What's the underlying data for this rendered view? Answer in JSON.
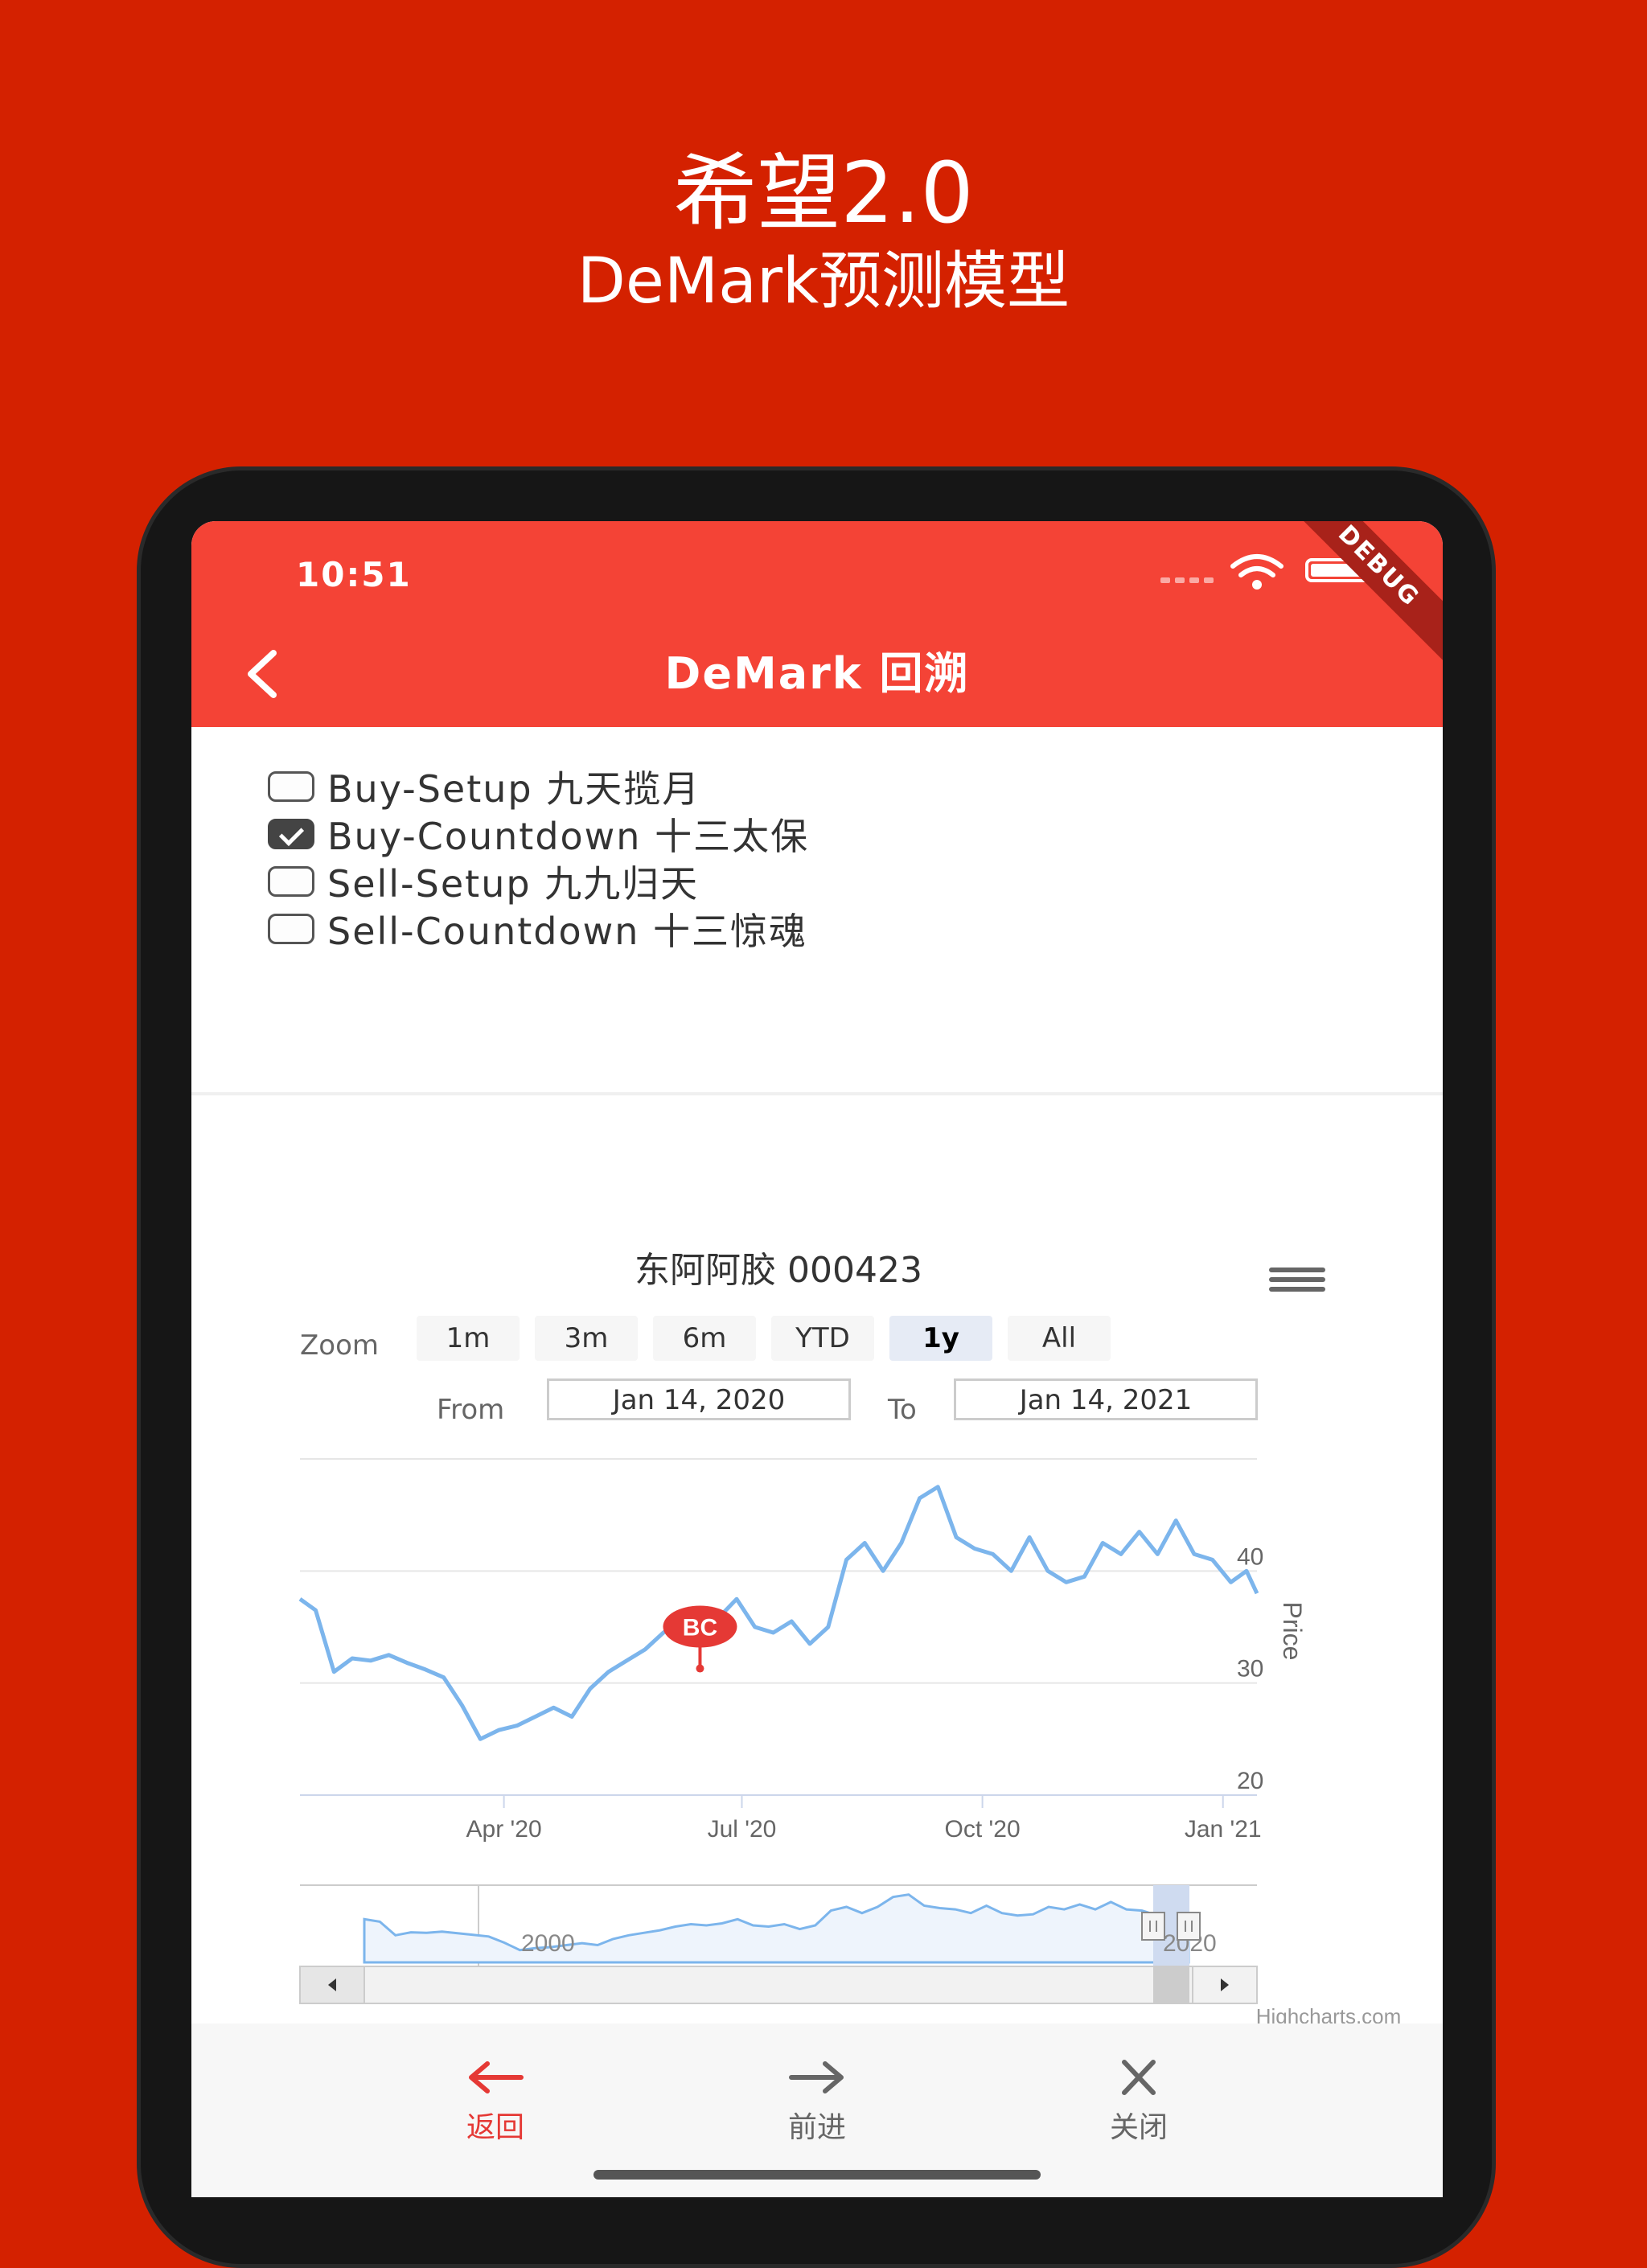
{
  "hero": {
    "title": "希望2.0",
    "subtitle": "DeMark预测模型"
  },
  "status": {
    "time": "10:51",
    "debug": "DEBUG"
  },
  "appbar": {
    "title": "DeMark 回溯"
  },
  "options": [
    {
      "label": "Buy-Setup 九天揽月",
      "checked": false
    },
    {
      "label": "Buy-Countdown 十三太保",
      "checked": true
    },
    {
      "label": "Sell-Setup 九九归天",
      "checked": false
    },
    {
      "label": "Sell-Countdown 十三惊魂",
      "checked": false
    }
  ],
  "chart": {
    "zoom_label": "Zoom",
    "zoom_buttons": [
      "1m",
      "3m",
      "6m",
      "YTD",
      "1y",
      "All"
    ],
    "zoom_active": "1y",
    "from_label": "From",
    "from_value": "Jan 14, 2020",
    "to_label": "To",
    "to_value": "Jan 14, 2021",
    "credit": "Highcharts.com",
    "flag_label": "BC",
    "navigator_labels": [
      "2000",
      "2020"
    ]
  },
  "chart_data": {
    "type": "line",
    "title": "东阿阿胶 000423",
    "ylabel": "Price",
    "xlabel": "",
    "ylim": [
      20,
      50
    ],
    "y_ticks": [
      20,
      30,
      40
    ],
    "x_ticks": [
      "Apr '20",
      "Jul '20",
      "Oct '20",
      "Jan '21"
    ],
    "x_range": [
      "2020-01-14",
      "2021-01-14"
    ],
    "grid": true,
    "series": [
      {
        "values": [
          [
            "2020-01-14",
            37.5
          ],
          [
            "2020-01-20",
            36.5
          ],
          [
            "2020-01-27",
            31.0
          ],
          [
            "2020-02-03",
            32.2
          ],
          [
            "2020-02-10",
            32.0
          ],
          [
            "2020-02-17",
            32.5
          ],
          [
            "2020-02-24",
            31.8
          ],
          [
            "2020-03-02",
            31.2
          ],
          [
            "2020-03-09",
            30.5
          ],
          [
            "2020-03-16",
            28.0
          ],
          [
            "2020-03-23",
            25.0
          ],
          [
            "2020-03-30",
            25.8
          ],
          [
            "2020-04-06",
            26.2
          ],
          [
            "2020-04-13",
            27.0
          ],
          [
            "2020-04-20",
            27.8
          ],
          [
            "2020-04-27",
            27.0
          ],
          [
            "2020-05-04",
            29.5
          ],
          [
            "2020-05-11",
            31.0
          ],
          [
            "2020-05-18",
            32.0
          ],
          [
            "2020-05-25",
            33.0
          ],
          [
            "2020-06-01",
            34.5
          ],
          [
            "2020-06-08",
            35.5
          ],
          [
            "2020-06-15",
            35.0
          ],
          [
            "2020-06-22",
            35.8
          ],
          [
            "2020-06-29",
            37.5
          ],
          [
            "2020-07-06",
            35.0
          ],
          [
            "2020-07-13",
            34.5
          ],
          [
            "2020-07-20",
            35.5
          ],
          [
            "2020-07-27",
            33.5
          ],
          [
            "2020-08-03",
            35.0
          ],
          [
            "2020-08-10",
            41.0
          ],
          [
            "2020-08-17",
            42.5
          ],
          [
            "2020-08-24",
            40.0
          ],
          [
            "2020-08-31",
            42.5
          ],
          [
            "2020-09-07",
            46.5
          ],
          [
            "2020-09-14",
            47.5
          ],
          [
            "2020-09-21",
            43.0
          ],
          [
            "2020-09-28",
            42.0
          ],
          [
            "2020-10-05",
            41.5
          ],
          [
            "2020-10-12",
            40.0
          ],
          [
            "2020-10-19",
            43.0
          ],
          [
            "2020-10-26",
            40.0
          ],
          [
            "2020-11-02",
            39.0
          ],
          [
            "2020-11-09",
            39.5
          ],
          [
            "2020-11-16",
            42.5
          ],
          [
            "2020-11-23",
            41.5
          ],
          [
            "2020-11-30",
            43.5
          ],
          [
            "2020-12-07",
            41.5
          ],
          [
            "2020-12-14",
            44.5
          ],
          [
            "2020-12-21",
            41.5
          ],
          [
            "2020-12-28",
            41.0
          ],
          [
            "2021-01-04",
            39.0
          ],
          [
            "2021-01-10",
            40.0
          ],
          [
            "2021-01-14",
            38.0
          ]
        ]
      }
    ],
    "flags": [
      {
        "date": "2020-06-15",
        "value": 31.3,
        "label": "BC"
      }
    ]
  },
  "bottom_nav": [
    {
      "label": "返回",
      "icon": "arrow-left-icon",
      "color": "#e53935"
    },
    {
      "label": "前进",
      "icon": "arrow-right-icon",
      "color": "#666666"
    },
    {
      "label": "关闭",
      "icon": "close-icon",
      "color": "#666666"
    }
  ]
}
